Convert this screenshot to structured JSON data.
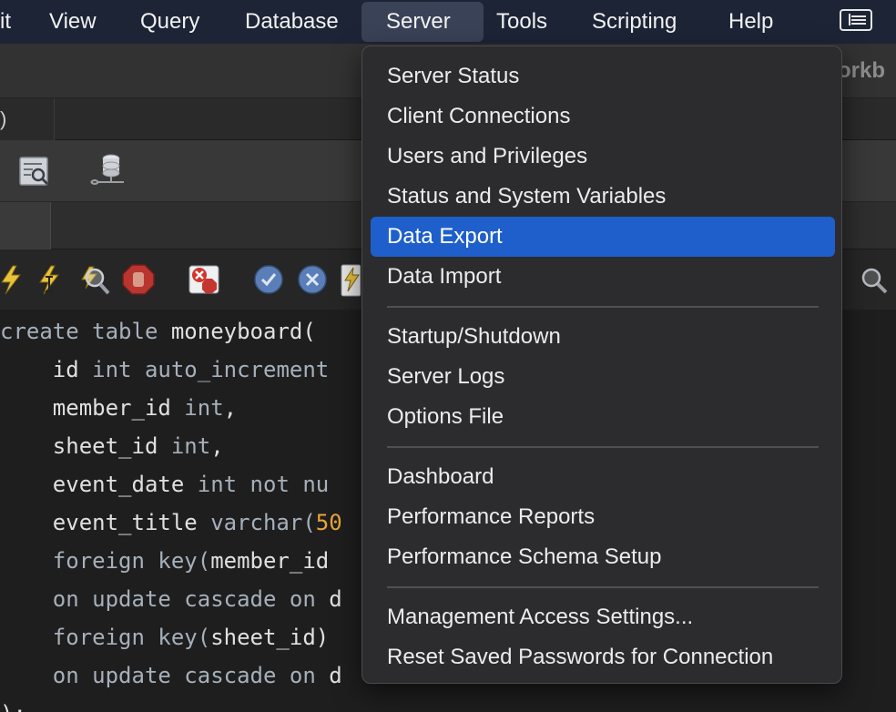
{
  "menubar": {
    "items": [
      "it",
      "View",
      "Query",
      "Database",
      "Server",
      "Tools",
      "Scripting",
      "Help"
    ],
    "active": "Server"
  },
  "window": {
    "title_fragment": "orkb"
  },
  "tab": {
    "label_fragment": ")"
  },
  "icons": {
    "sql_inspector": "sql-inspector-icon",
    "database_connection": "database-connection-icon",
    "execute": "lightning-execute-icon",
    "execute_current": "lightning-cursor-icon",
    "explain": "explain-magnifier-icon",
    "stop": "stop-hand-icon",
    "stop_on_error": "stop-on-error-icon",
    "commit": "commit-check-icon",
    "rollback": "rollback-x-icon",
    "autocommit": "autocommit-icon",
    "find": "find-magnifier-icon",
    "screen": "window-layout-icon"
  },
  "code": {
    "lines": [
      [
        {
          "t": "create table ",
          "c": "kw"
        },
        {
          "t": "moneyboard(",
          "c": ""
        }
      ],
      [
        {
          "t": "    id ",
          "c": ""
        },
        {
          "t": "int auto_increment",
          "c": "kw"
        }
      ],
      [
        {
          "t": "    member_id ",
          "c": ""
        },
        {
          "t": "int",
          "c": "kw"
        },
        {
          "t": ",",
          "c": ""
        }
      ],
      [
        {
          "t": "    sheet_id ",
          "c": ""
        },
        {
          "t": "int",
          "c": "kw"
        },
        {
          "t": ",",
          "c": ""
        }
      ],
      [
        {
          "t": "    event_date ",
          "c": ""
        },
        {
          "t": "int not nu",
          "c": "kw"
        }
      ],
      [
        {
          "t": "    event_title ",
          "c": ""
        },
        {
          "t": "varchar(",
          "c": "kw"
        },
        {
          "t": "50",
          "c": "num"
        }
      ],
      [
        {
          "t": "    foreign key(",
          "c": "kw"
        },
        {
          "t": "member_id",
          "c": ""
        }
      ],
      [
        {
          "t": "    on update cascade on ",
          "c": "kw"
        },
        {
          "t": "d",
          "c": ""
        }
      ],
      [
        {
          "t": "    foreign key(",
          "c": "kw"
        },
        {
          "t": "sheet_id)",
          "c": ""
        }
      ],
      [
        {
          "t": "    on update cascade on ",
          "c": "kw"
        },
        {
          "t": "d",
          "c": ""
        }
      ],
      [
        {
          "t": ");",
          "c": ""
        }
      ]
    ]
  },
  "dropdown": {
    "groups": [
      [
        "Server Status",
        "Client Connections",
        "Users and Privileges",
        "Status and System Variables",
        "Data Export",
        "Data Import"
      ],
      [
        "Startup/Shutdown",
        "Server Logs",
        "Options File"
      ],
      [
        "Dashboard",
        "Performance Reports",
        "Performance Schema Setup"
      ],
      [
        "Management Access Settings...",
        "Reset Saved Passwords for Connection"
      ]
    ],
    "selected": "Data Export"
  }
}
